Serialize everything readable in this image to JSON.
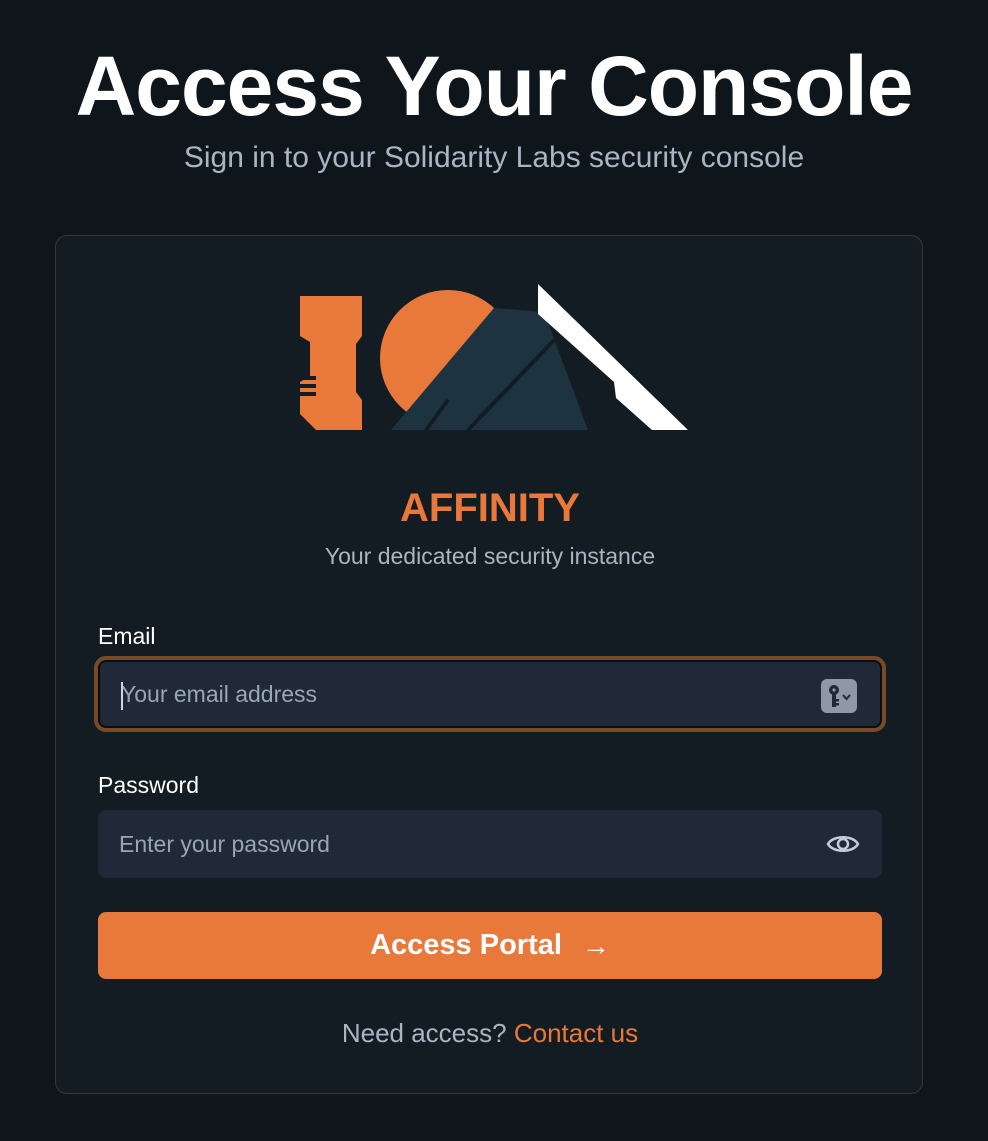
{
  "header": {
    "title": "Access Your Console",
    "subtitle": "Sign in to your Solidarity Labs security console"
  },
  "brand": {
    "logo_icon": "affinity-logo",
    "name": "AFFINITY",
    "tagline": "Your dedicated security instance",
    "colors": {
      "accent": "#e8793a",
      "mountain": "#1e3340",
      "peak": "#ffffff"
    }
  },
  "form": {
    "email": {
      "label": "Email",
      "placeholder": "Your email address",
      "value": "",
      "icon": "password-manager-key-icon"
    },
    "password": {
      "label": "Password",
      "placeholder": "Enter your password",
      "value": "",
      "icon": "eye-icon"
    },
    "submit": {
      "label": "Access Portal",
      "icon": "arrow-right-icon",
      "arrow": "→"
    }
  },
  "footer": {
    "prompt": "Need access?",
    "link_label": "Contact us"
  }
}
